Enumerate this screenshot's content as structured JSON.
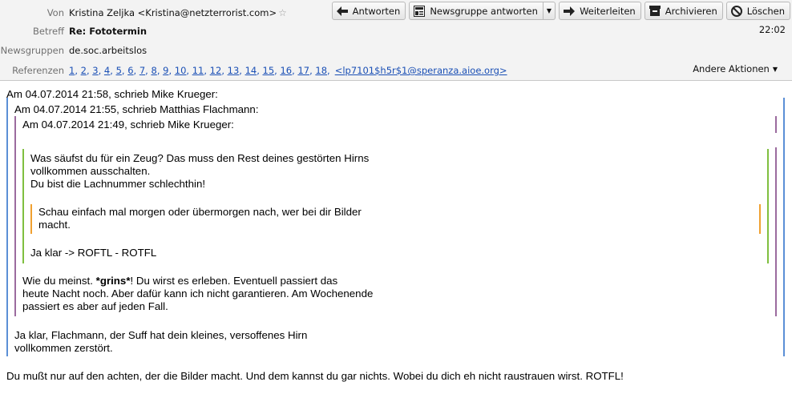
{
  "header": {
    "from_label": "Von",
    "from_value": "Kristina Zeljka <Kristina@netzterrorist.com>",
    "subject_label": "Betreff",
    "subject_value": "Re: Fototermin",
    "newsgroups_label": "Newsgruppen",
    "newsgroups_value": "de.soc.arbeitslos",
    "references_label": "Referenzen",
    "references": [
      "1",
      "2",
      "3",
      "4",
      "5",
      "6",
      "7",
      "8",
      "9",
      "10",
      "11",
      "12",
      "13",
      "14",
      "15",
      "16",
      "17",
      "18"
    ],
    "message_id_ref": "<lp7101$h5r$1@speranza.aioe.org>",
    "time": "22:02",
    "other_actions": "Andere Aktionen"
  },
  "toolbar": {
    "reply": "Antworten",
    "reply_group": "Newsgruppe antworten",
    "forward": "Weiterleiten",
    "archive": "Archivieren",
    "delete": "Löschen"
  },
  "message": {
    "attrib1": "Am 04.07.2014 21:58, schrieb Mike Krueger:",
    "attrib2": "Am 04.07.2014 21:55, schrieb Matthias Flachmann:",
    "attrib3": "Am 04.07.2014 21:49, schrieb Mike Krueger:",
    "q4_line1": "Was säufst du für ein Zeug? Das muss den Rest deines gestörten Hirns",
    "q4_line2": "vollkommen ausschalten.",
    "q4_line3": "Du bist die Lachnummer schlechthin!",
    "q5_line1": "Schau einfach mal morgen oder übermorgen nach, wer bei dir Bilder",
    "q5_line2": "macht.",
    "q4_line4": "Ja klar -> ROFTL - ROTFL",
    "q3_line1a": "Wie du meinst. ",
    "q3_line1b": "*grins*",
    "q3_line1c": "! Du wirst es erleben. Eventuell passiert das",
    "q3_line2": "heute Nacht noch. Aber dafür kann ich nicht garantieren. Am Wochenende",
    "q3_line3": "passiert es aber auf jeden Fall.",
    "q2_line1": "Ja klar, Flachmann, der Suff hat dein kleines, versoffenes Hirn",
    "q2_line2": "vollkommen zerstört.",
    "reply_line": "Du mußt nur auf den achten, der die Bilder macht. Und dem kannst du gar nichts. Wobei du dich eh nicht raustrauen wirst. ROTFL!"
  },
  "colors": {
    "level1": "#5b8fd6",
    "level2": "#9b6b9e",
    "level3": "#7fbf3f",
    "level4": "#f0a030"
  }
}
